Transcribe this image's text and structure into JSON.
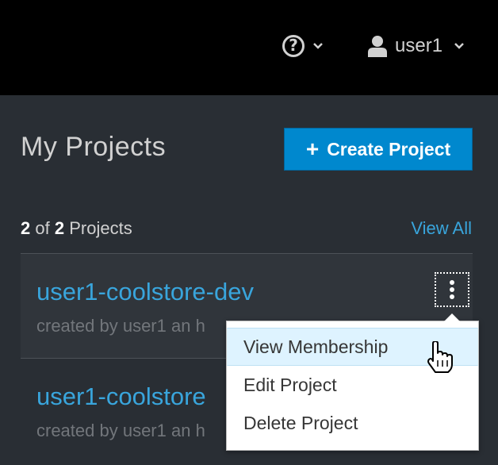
{
  "header": {
    "help_icon": "question-circle-icon",
    "help_caret": "chevron-down-icon",
    "user_icon": "user-icon",
    "user_name": "user1",
    "user_caret": "chevron-down-icon"
  },
  "main": {
    "title": "My Projects",
    "create_button": {
      "icon": "plus-icon",
      "label": "Create Project"
    },
    "count": {
      "shown": "2",
      "of": "of",
      "total": "2",
      "suffix": "Projects"
    },
    "view_all": "View All"
  },
  "projects": [
    {
      "name": "user1-coolstore-dev",
      "meta": "created by user1 an h"
    },
    {
      "name": "user1-coolstore",
      "meta": "created by user1 an h"
    }
  ],
  "kebab_menu": {
    "items": [
      {
        "label": "View Membership",
        "state": "hover"
      },
      {
        "label": "Edit Project"
      },
      {
        "label": "Delete Project"
      }
    ]
  },
  "colors": {
    "topbar": "#000000",
    "background": "#292e34",
    "accent": "#0088ce",
    "link": "#39a5dc",
    "menu_hover": "#def3ff"
  },
  "cursor": "hand-pointer-icon"
}
